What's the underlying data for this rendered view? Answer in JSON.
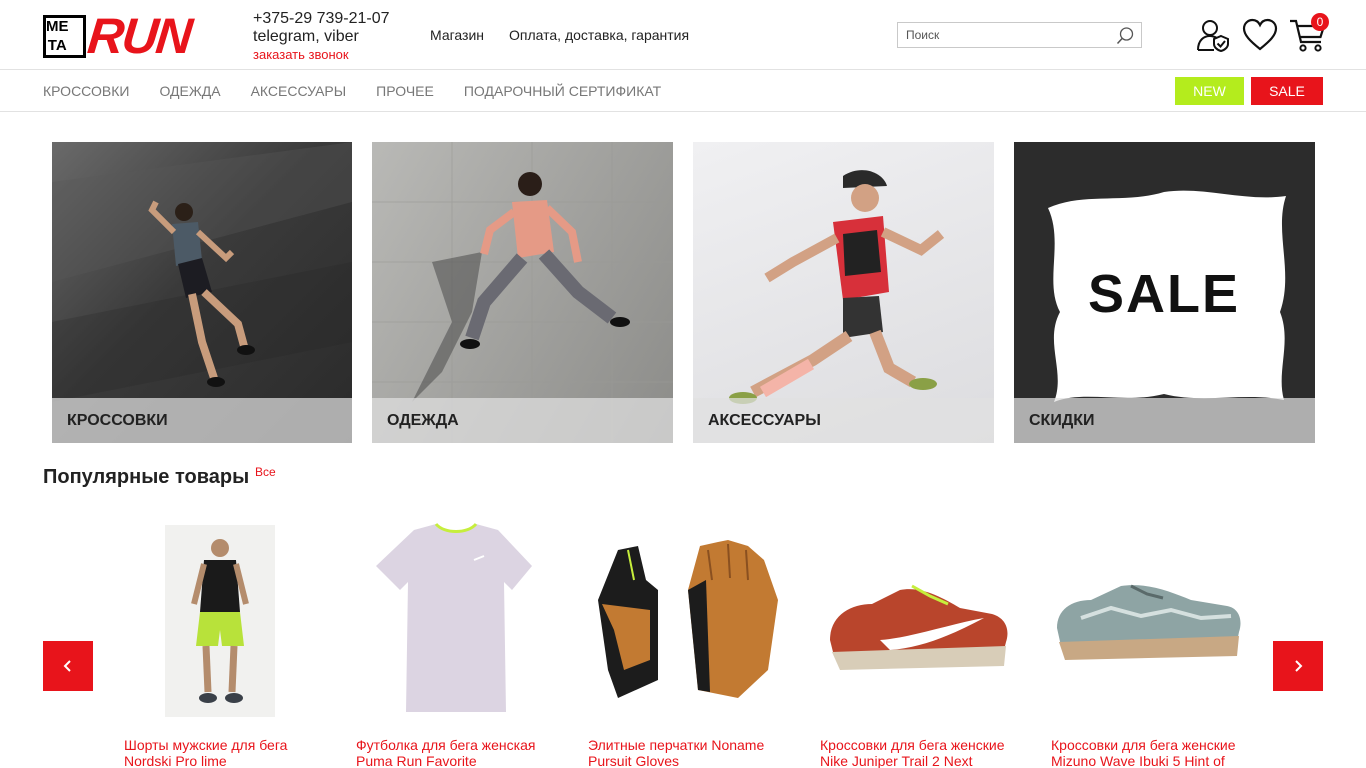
{
  "brand": {
    "logo_top_left": "ME",
    "logo_top_right": "",
    "logo_bottom_left": "TA",
    "logo_text": "RUN"
  },
  "contacts": {
    "phone": "+375-29 739-21-07",
    "messengers": "telegram, viber",
    "callback": "заказать звонок"
  },
  "top_links": [
    "Магазин",
    "Оплата, доставка, гарантия"
  ],
  "search": {
    "placeholder": "Поиск"
  },
  "cart": {
    "count": "0"
  },
  "nav": {
    "items": [
      "КРОССОВКИ",
      "ОДЕЖДА",
      "АКСЕССУАРЫ",
      "ПРОЧЕЕ",
      "ПОДАРОЧНЫЙ СЕРТИФИКАТ"
    ],
    "new_label": "NEW",
    "sale_label": "SALE"
  },
  "categories": [
    {
      "label": "КРОССОВКИ"
    },
    {
      "label": "ОДЕЖДА"
    },
    {
      "label": "АКСЕССУАРЫ"
    },
    {
      "label": "СКИДКИ",
      "image_text": "SALE"
    }
  ],
  "popular": {
    "title": "Популярные товары",
    "all_link": "Все",
    "products": [
      {
        "name_line1": "Шорты мужские для бега",
        "name_line2": "Nordski Pro lime"
      },
      {
        "name_line1": "Футболка для бега женская",
        "name_line2": "Puma Run Favorite"
      },
      {
        "name_line1": "Элитные перчатки Noname",
        "name_line2": "Pursuit Gloves"
      },
      {
        "name_line1": "Кроссовки для бега женские",
        "name_line2": "Nike Juniper Trail 2 Next"
      },
      {
        "name_line1": "Кроссовки для бега женские",
        "name_line2": "Mizuno Wave Ibuki 5 Hint of"
      }
    ]
  },
  "colors": {
    "accent": "#e8141b",
    "new": "#b4ec1d"
  },
  "icons": [
    "search-icon",
    "user-check-icon",
    "heart-icon",
    "cart-icon",
    "chevron-left-icon",
    "chevron-right-icon"
  ]
}
